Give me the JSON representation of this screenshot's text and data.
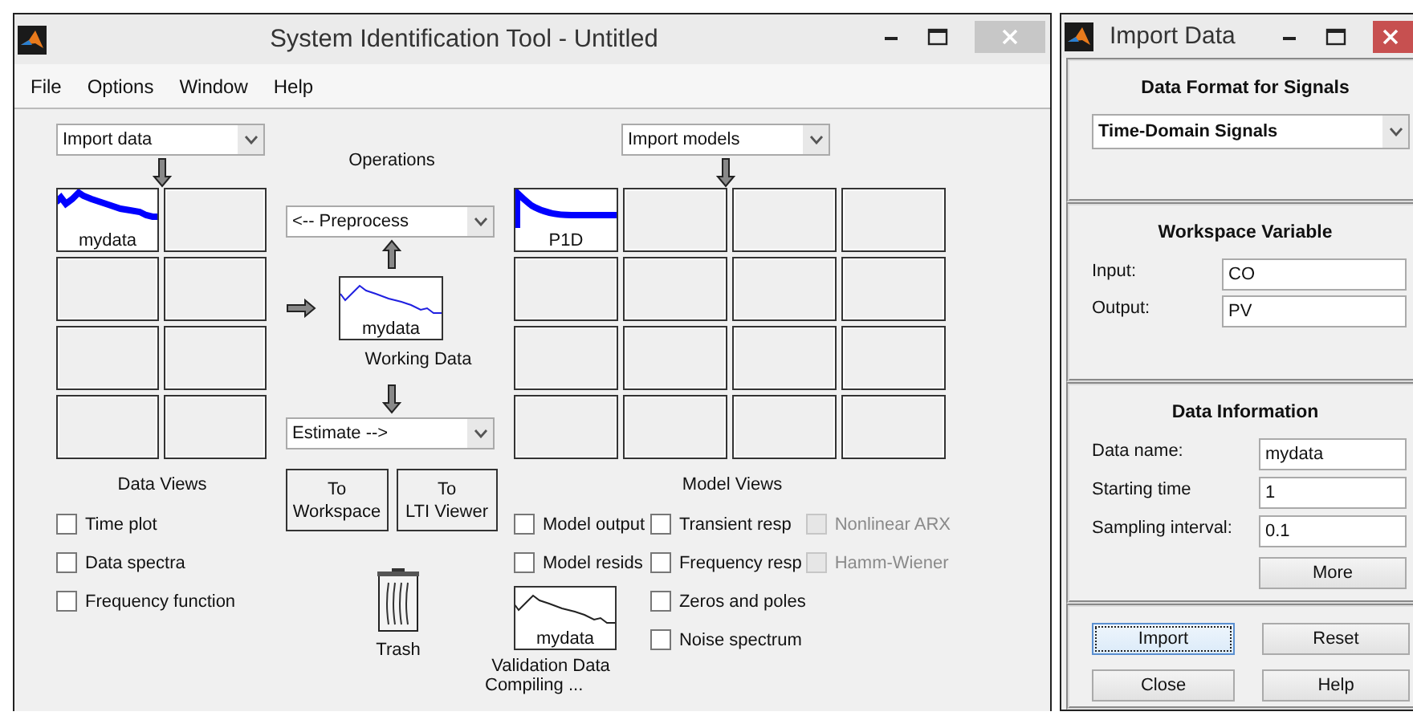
{
  "main_window": {
    "title": "System Identification Tool - Untitled",
    "menu": [
      "File",
      "Options",
      "Window",
      "Help"
    ],
    "import_data": {
      "value": "Import data"
    },
    "data_board": [
      {
        "kind": "data",
        "label": "mydata"
      },
      {
        "kind": "empty"
      },
      {
        "kind": "empty"
      },
      {
        "kind": "empty"
      },
      {
        "kind": "empty"
      },
      {
        "kind": "empty"
      },
      {
        "kind": "empty"
      },
      {
        "kind": "empty"
      }
    ],
    "operations": {
      "title": "Operations",
      "preprocess": "<-- Preprocess",
      "working_data": {
        "label": "mydata",
        "caption": "Working Data"
      },
      "estimate": "Estimate -->"
    },
    "export_buttons": [
      {
        "lines": [
          "To",
          "Workspace"
        ]
      },
      {
        "lines": [
          "To",
          "LTI Viewer"
        ]
      }
    ],
    "data_views": {
      "title": "Data Views",
      "options": [
        {
          "label": "Time plot",
          "checked": false,
          "disabled": false
        },
        {
          "label": "Data spectra",
          "checked": false,
          "disabled": false
        },
        {
          "label": "Frequency function",
          "checked": false,
          "disabled": false
        }
      ]
    },
    "trash": {
      "label": "Trash"
    },
    "import_models": {
      "value": "Import models"
    },
    "model_board": [
      {
        "kind": "model",
        "label": "P1D"
      },
      {
        "kind": "empty"
      },
      {
        "kind": "empty"
      },
      {
        "kind": "empty"
      },
      {
        "kind": "empty"
      },
      {
        "kind": "empty"
      },
      {
        "kind": "empty"
      },
      {
        "kind": "empty"
      },
      {
        "kind": "empty"
      },
      {
        "kind": "empty"
      },
      {
        "kind": "empty"
      },
      {
        "kind": "empty"
      },
      {
        "kind": "empty"
      },
      {
        "kind": "empty"
      },
      {
        "kind": "empty"
      },
      {
        "kind": "empty"
      }
    ],
    "model_views": {
      "title": "Model Views",
      "columns": [
        [
          {
            "label": "Model output",
            "checked": false,
            "disabled": false
          },
          {
            "label": "Model resids",
            "checked": false,
            "disabled": false
          }
        ],
        [
          {
            "label": "Transient resp",
            "checked": false,
            "disabled": false
          },
          {
            "label": "Frequency resp",
            "checked": false,
            "disabled": false
          },
          {
            "label": "Zeros and poles",
            "checked": false,
            "disabled": false
          },
          {
            "label": "Noise spectrum",
            "checked": false,
            "disabled": false
          }
        ],
        [
          {
            "label": "Nonlinear ARX",
            "checked": false,
            "disabled": true
          },
          {
            "label": "Hamm-Wiener",
            "checked": false,
            "disabled": true
          }
        ]
      ]
    },
    "validation_data": {
      "label": "mydata",
      "caption": "Validation Data"
    },
    "status": "Compiling ..."
  },
  "import_window": {
    "title": "Import Data",
    "data_format": {
      "title": "Data Format for Signals",
      "value": "Time-Domain Signals"
    },
    "workspace_variable": {
      "title": "Workspace Variable",
      "fields": [
        {
          "label": "Input:",
          "value": "CO"
        },
        {
          "label": "Output:",
          "value": "PV"
        }
      ]
    },
    "data_information": {
      "title": "Data Information",
      "fields": [
        {
          "label": "Data name:",
          "value": "mydata"
        },
        {
          "label": "Starting time",
          "value": "1"
        },
        {
          "label": "Sampling interval:",
          "value": "0.1"
        }
      ],
      "more": "More"
    },
    "buttons": [
      {
        "label": "Import",
        "focused": true
      },
      {
        "label": "Reset",
        "focused": false
      },
      {
        "label": "Close",
        "focused": false
      },
      {
        "label": "Help",
        "focused": false
      }
    ]
  }
}
